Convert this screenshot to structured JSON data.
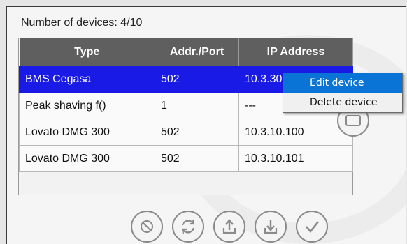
{
  "header": {
    "device_count_label": "Number of devices: 4/10"
  },
  "table": {
    "columns": [
      "Type",
      "Addr./Port",
      "IP Address"
    ],
    "rows": [
      {
        "type": "BMS Cegasa",
        "addr": "502",
        "ip": "10.3.30",
        "selected": true
      },
      {
        "type": "Peak shaving f()",
        "addr": "1",
        "ip": "---",
        "selected": false
      },
      {
        "type": "Lovato DMG 300",
        "addr": "502",
        "ip": "10.3.10.100",
        "selected": false
      },
      {
        "type": "Lovato DMG 300",
        "addr": "502",
        "ip": "10.3.10.101",
        "selected": false
      }
    ]
  },
  "context_menu": {
    "items": [
      "Edit device",
      "Delete device"
    ],
    "highlighted_index": 0
  },
  "toolbar": {
    "buttons": [
      "cancel-icon",
      "refresh-icon",
      "upload-icon",
      "download-icon",
      "confirm-icon"
    ]
  },
  "colors": {
    "selected_row": "#1a1ae6",
    "header_bg": "#5f5f5f",
    "menu_highlight": "#0a73d6"
  }
}
